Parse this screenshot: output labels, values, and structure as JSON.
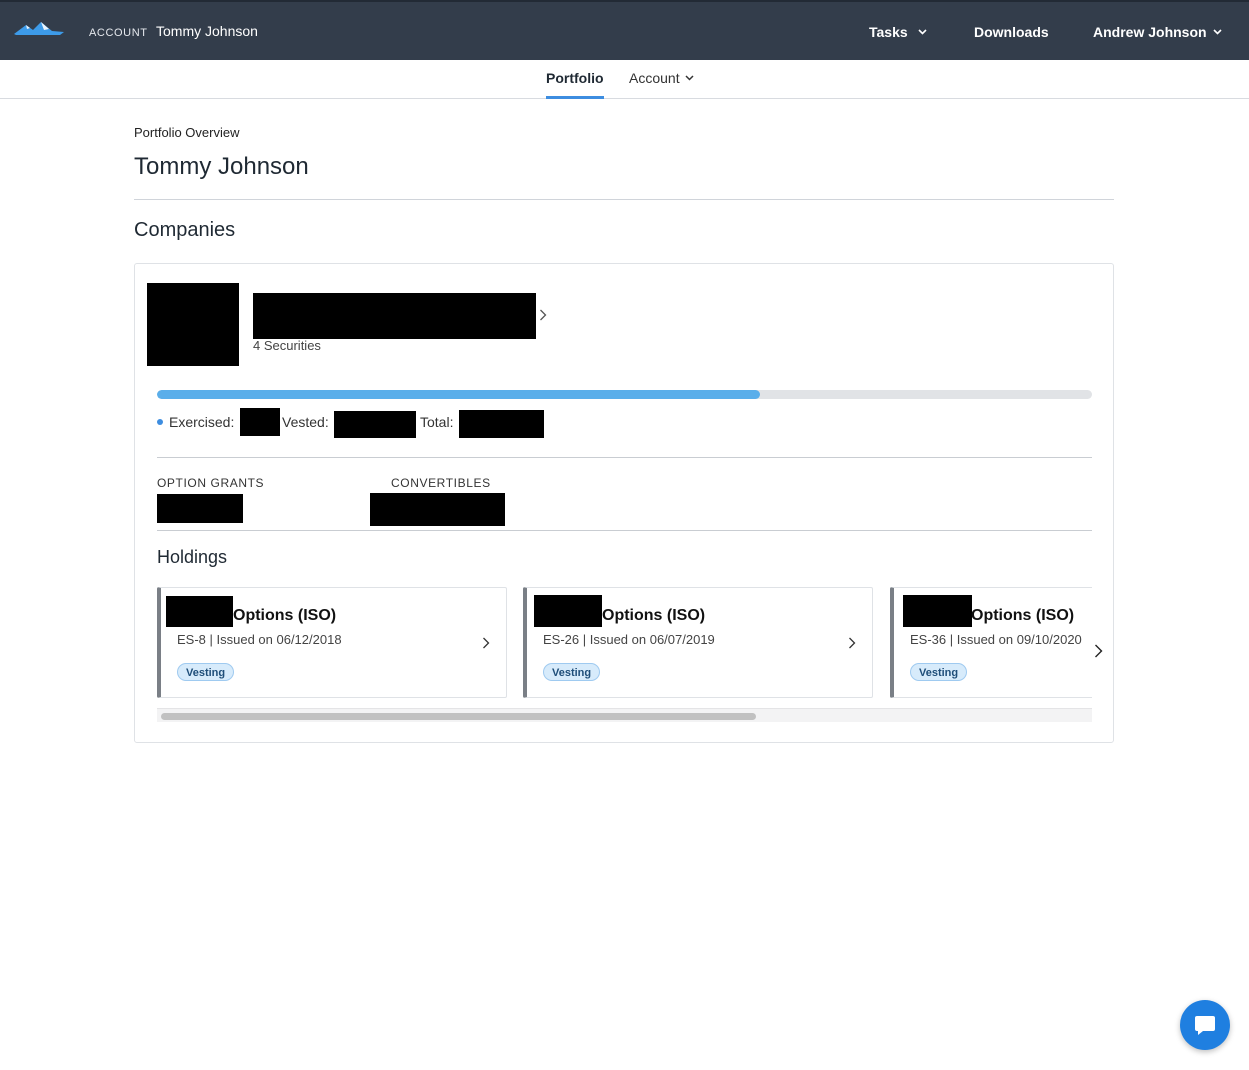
{
  "header": {
    "account_label": "ACCOUNT",
    "account_name": "Tommy Johnson",
    "tasks_label": "Tasks",
    "downloads_label": "Downloads",
    "user_name": "Andrew Johnson",
    "logo_icon": "mountain-logo-icon",
    "bg_color": "#333d4b"
  },
  "subnav": {
    "portfolio_label": "Portfolio",
    "account_label": "Account",
    "active_color": "#3d8de0"
  },
  "page": {
    "breadcrumb": "Portfolio Overview",
    "title": "Tommy Johnson",
    "companies_heading": "Companies"
  },
  "company": {
    "securities": "4 Securities",
    "progress_fraction": 0.645,
    "exercised_label": "Exercised:",
    "vested_label": "Vested:",
    "total_label": "Total:",
    "option_grants_label": "OPTION GRANTS",
    "convertibles_label": "CONVERTIBLES",
    "holdings_heading": "Holdings",
    "holdings": [
      {
        "title": "Options (ISO)",
        "subtitle": "ES-8 | Issued on 06/12/2018",
        "badge": "Vesting"
      },
      {
        "title": "Options (ISO)",
        "subtitle": "ES-26 | Issued on 06/07/2019",
        "badge": "Vesting"
      },
      {
        "title": "Options (ISO)",
        "subtitle": "ES-36 | Issued on 09/10/2020",
        "badge": "Vesting"
      }
    ]
  },
  "chat": {
    "icon": "chat-bubble-icon",
    "color": "#1f7fe0"
  }
}
